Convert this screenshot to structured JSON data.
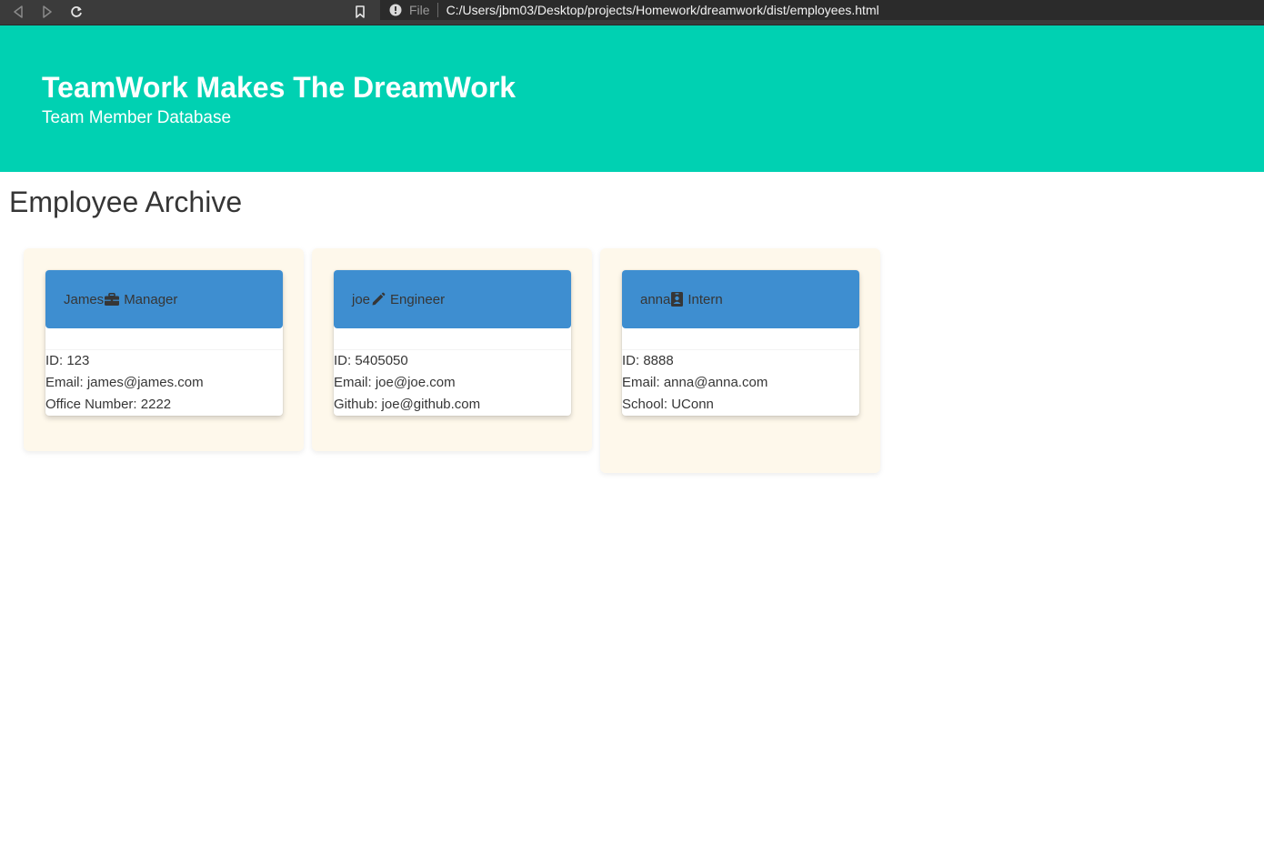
{
  "browser": {
    "scheme_label": "File",
    "url": "C:/Users/jbm03/Desktop/projects/Homework/dreamwork/dist/employees.html"
  },
  "hero": {
    "title": "TeamWork Makes The DreamWork",
    "subtitle": "Team Member Database"
  },
  "page": {
    "heading": "Employee Archive"
  },
  "colors": {
    "hero_bg": "#00d1b2",
    "card_header_bg": "#3e8ed0",
    "tile_bg": "#fef8eb"
  },
  "employees": [
    {
      "name": "James",
      "role": "Manager",
      "icon": "briefcase-icon",
      "id_line": "ID: 123",
      "email_line": "Email: james@james.com",
      "extra_line": "Office Number: 2222"
    },
    {
      "name": "joe",
      "role": "Engineer",
      "icon": "pencil-icon",
      "id_line": "ID: 5405050",
      "email_line": "Email: joe@joe.com",
      "extra_line": "Github: joe@github.com"
    },
    {
      "name": "anna",
      "role": "Intern",
      "icon": "id-badge-icon",
      "id_line": "ID: 8888",
      "email_line": "Email: anna@anna.com",
      "extra_line": "School: UConn"
    }
  ]
}
